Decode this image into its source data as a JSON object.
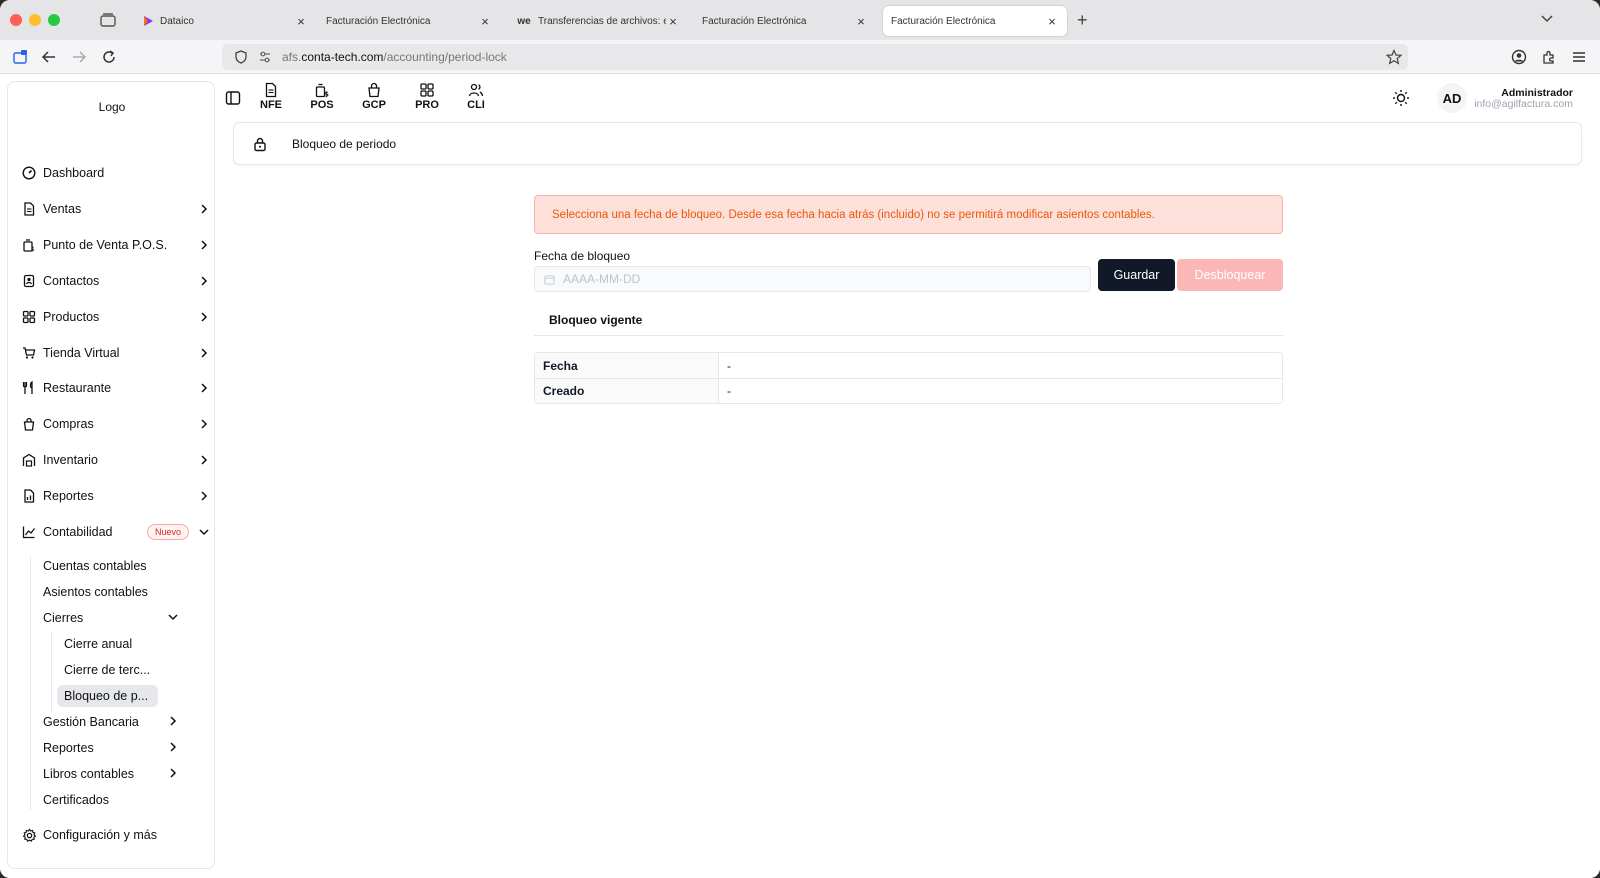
{
  "browser": {
    "tabs": [
      {
        "title": "Dataico",
        "favicon": "dataico-play-icon",
        "active": false
      },
      {
        "title": "Facturación Electrónica",
        "favicon": "",
        "active": false
      },
      {
        "title": "Transferencias de archivos: el c",
        "favicon": "we-icon",
        "active": false
      },
      {
        "title": "Facturación Electrónica",
        "favicon": "",
        "active": false
      },
      {
        "title": "Facturación Electrónica",
        "favicon": "",
        "active": true
      }
    ],
    "url": {
      "prefix": "afs.",
      "host": "conta-tech.com",
      "path": "/accounting/period-lock"
    }
  },
  "sidebar": {
    "logo": "Logo",
    "items": [
      {
        "label": "Dashboard",
        "icon": "dashboard-icon",
        "chevron": false
      },
      {
        "label": "Ventas",
        "icon": "document-icon",
        "chevron": true
      },
      {
        "label": "Punto de Venta P.O.S.",
        "icon": "pos-icon",
        "chevron": true
      },
      {
        "label": "Contactos",
        "icon": "contacts-icon",
        "chevron": true
      },
      {
        "label": "Productos",
        "icon": "grid-icon",
        "chevron": true
      },
      {
        "label": "Tienda Virtual",
        "icon": "cart-icon",
        "chevron": true
      },
      {
        "label": "Restaurante",
        "icon": "utensils-icon",
        "chevron": true
      },
      {
        "label": "Compras",
        "icon": "shopping-bag-icon",
        "chevron": true
      },
      {
        "label": "Inventario",
        "icon": "warehouse-icon",
        "chevron": true
      },
      {
        "label": "Reportes",
        "icon": "report-icon",
        "chevron": true
      },
      {
        "label": "Contabilidad",
        "icon": "chart-icon",
        "chevron": true,
        "badge": "Nuevo",
        "expanded": true
      }
    ],
    "accounting_sub": [
      {
        "label": "Cuentas contables",
        "chevron": false
      },
      {
        "label": "Asientos contables",
        "chevron": false
      },
      {
        "label": "Cierres",
        "chevron": true,
        "expanded": true
      },
      {
        "label": "Gestión Bancaria",
        "chevron": true
      },
      {
        "label": "Reportes",
        "chevron": true
      },
      {
        "label": "Libros contables",
        "chevron": true
      },
      {
        "label": "Certificados",
        "chevron": false
      }
    ],
    "closings_sub": [
      {
        "label": "Cierre anual",
        "active": false
      },
      {
        "label": "Cierre de terc...",
        "active": false
      },
      {
        "label": "Bloqueo de p...",
        "active": true
      }
    ],
    "settings": {
      "label": "Configuración y más",
      "icon": "gear-icon"
    }
  },
  "toolbar": {
    "quick_links": [
      {
        "label": "NFE",
        "icon": "invoice-icon"
      },
      {
        "label": "POS",
        "icon": "pos-icon"
      },
      {
        "label": "GCP",
        "icon": "bag-icon"
      },
      {
        "label": "PRO",
        "icon": "grid-icon"
      },
      {
        "label": "CLI",
        "icon": "users-icon"
      }
    ]
  },
  "user": {
    "initials": "AD",
    "name": "Administrador",
    "email": "info@agilfactura.com"
  },
  "page": {
    "title": "Bloqueo de periodo",
    "alert": "Selecciona una fecha de bloqueo. Desde esa fecha hacia atrás (incluido) no se permitirá modificar asientos contables.",
    "date_label": "Fecha de bloqueo",
    "date_placeholder": "AAAA-MM-DD",
    "date_value": "",
    "save_label": "Guardar",
    "unlock_label": "Desbloquear",
    "current_title": "Bloqueo vigente",
    "current": [
      {
        "key": "Fecha",
        "value": "-"
      },
      {
        "key": "Creado",
        "value": "-"
      }
    ]
  },
  "colors": {
    "primary": "#111827",
    "unlock_disabled": "#fbb7b5",
    "alert_bg": "#fde0da",
    "alert_text": "#ea580c",
    "badge": "#dc2626"
  }
}
